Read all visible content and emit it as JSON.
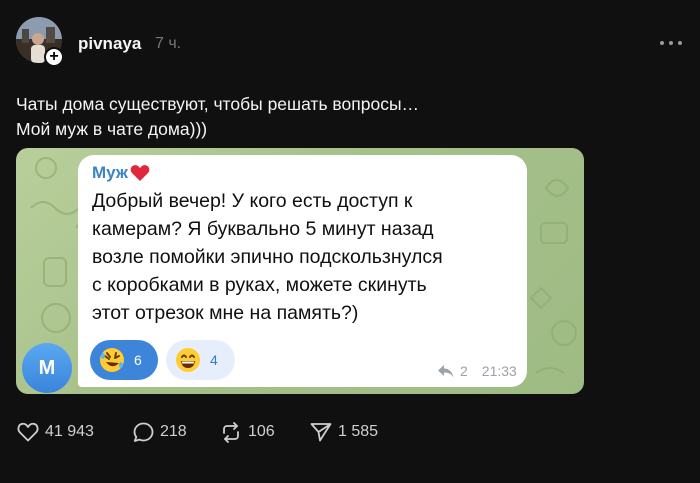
{
  "post": {
    "username": "pivnaya",
    "time": "7 ч.",
    "caption_lines": [
      "Чаты дома существуют, чтобы решать вопросы…",
      "Мой муж в чате дома)))"
    ],
    "image": {
      "avatar_letter": "M",
      "sender": "Муж",
      "sender_emoji": "red-heart",
      "message_lines": [
        "Добрый вечер! У кого есть доступ к",
        "камерам? Я буквально 5 минут назад",
        "возле помойки эпично подскользнулся",
        "с коробками в руках, можете скинуть",
        "этот отрезок мне на память?)"
      ],
      "reactions": [
        {
          "emoji": "rolling-on-floor-laughing",
          "count": "6"
        },
        {
          "emoji": "grinning-face",
          "count": "4"
        }
      ],
      "reply_count": "2",
      "timestamp": "21:33"
    },
    "stats": {
      "likes": "41 943",
      "comments": "218",
      "reposts": "106",
      "shares": "1 585"
    }
  },
  "colors": {
    "background": "#101010",
    "chat_bg": "#a8c28c",
    "sender_name": "#3c83c7",
    "reaction_active": "#3d85d8",
    "reaction_inactive": "#e5eefa"
  }
}
